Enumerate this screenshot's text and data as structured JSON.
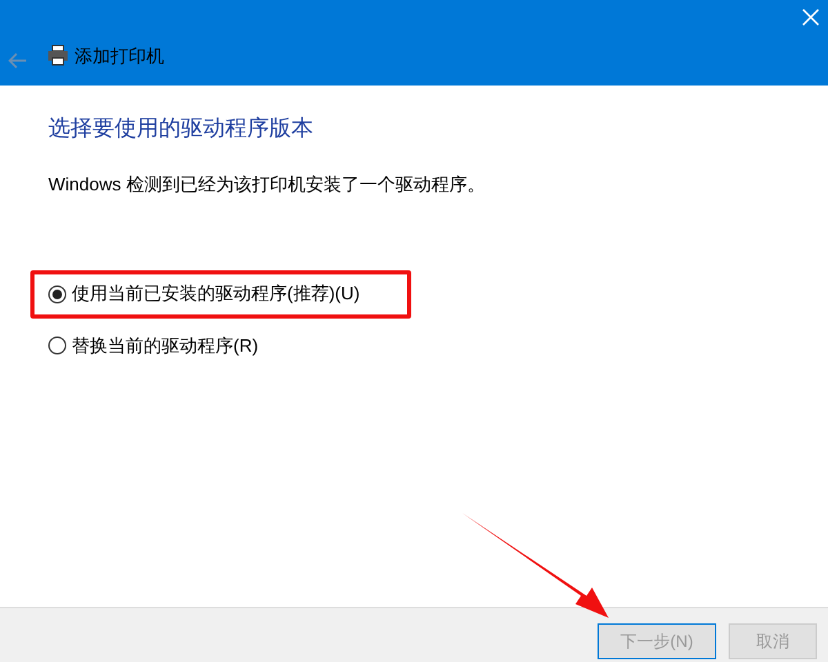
{
  "window": {
    "title": "添加打印机"
  },
  "heading": "选择要使用的驱动程序版本",
  "description": "Windows 检测到已经为该打印机安装了一个驱动程序。",
  "options": [
    {
      "label": "使用当前已安装的驱动程序(推荐)(U)",
      "selected": true,
      "highlighted": true
    },
    {
      "label": "替换当前的驱动程序(R)",
      "selected": false,
      "highlighted": false
    }
  ],
  "buttons": [
    {
      "label": "下一步(N)",
      "kind": "primary"
    },
    {
      "label": "取消",
      "kind": "secondary"
    }
  ]
}
